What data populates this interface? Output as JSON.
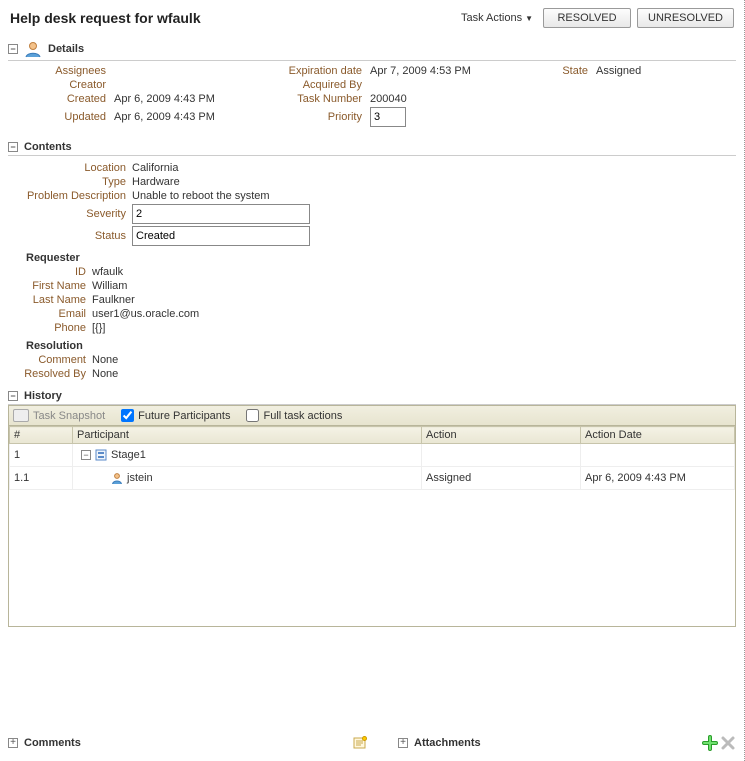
{
  "header": {
    "title": "Help desk request for wfaulk",
    "task_actions_label": "Task Actions",
    "resolved_button": "RESOLVED",
    "unresolved_button": "UNRESOLVED"
  },
  "details": {
    "heading": "Details",
    "labels": {
      "assignees": "Assignees",
      "creator": "Creator",
      "created": "Created",
      "updated": "Updated",
      "expiration_date": "Expiration date",
      "acquired_by": "Acquired By",
      "task_number": "Task Number",
      "priority": "Priority",
      "state": "State"
    },
    "values": {
      "assignees": "",
      "creator": "",
      "created": "Apr 6, 2009 4:43 PM",
      "updated": "Apr 6, 2009 4:43 PM",
      "expiration_date": "Apr 7, 2009 4:53 PM",
      "acquired_by": "",
      "task_number": "200040",
      "priority": "3",
      "state": "Assigned"
    }
  },
  "contents": {
    "heading": "Contents",
    "labels": {
      "location": "Location",
      "type": "Type",
      "problem_description": "Problem Description",
      "severity": "Severity",
      "status": "Status"
    },
    "values": {
      "location": "California",
      "type": "Hardware",
      "problem_description": "Unable to reboot the system",
      "severity": "2",
      "status": "Created"
    },
    "requester": {
      "heading": "Requester",
      "labels": {
        "id": "ID",
        "first_name": "First Name",
        "last_name": "Last Name",
        "email": "Email",
        "phone": "Phone"
      },
      "values": {
        "id": "wfaulk",
        "first_name": "William",
        "last_name": "Faulkner",
        "email": "user1@us.oracle.com",
        "phone": "[{}]"
      }
    },
    "resolution": {
      "heading": "Resolution",
      "labels": {
        "comment": "Comment",
        "resolved_by": "Resolved By"
      },
      "values": {
        "comment": "None",
        "resolved_by": "None"
      }
    }
  },
  "history": {
    "heading": "History",
    "toolbar": {
      "snapshot": "Task Snapshot",
      "future_participants": "Future Participants",
      "full_task_actions": "Full task actions"
    },
    "columns": {
      "num": "#",
      "participant": "Participant",
      "action": "Action",
      "action_date": "Action Date"
    },
    "rows": [
      {
        "num": "1",
        "participant": "Stage1",
        "action": "",
        "action_date": "",
        "type": "stage"
      },
      {
        "num": "1.1",
        "participant": "jstein",
        "action": "Assigned",
        "action_date": "Apr 6, 2009 4:43 PM",
        "type": "user"
      }
    ]
  },
  "footer": {
    "comments": "Comments",
    "attachments": "Attachments"
  }
}
